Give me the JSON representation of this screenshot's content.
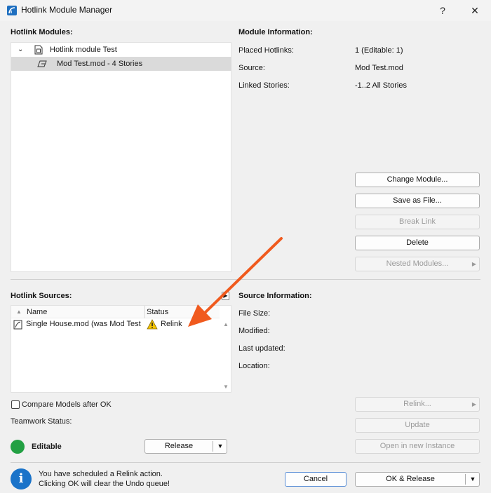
{
  "window": {
    "title": "Hotlink Module Manager",
    "help_label": "?",
    "close_label": "✕"
  },
  "modules": {
    "heading": "Hotlink Modules:",
    "tree": [
      {
        "label": "Hotlink module Test",
        "expanded": true
      },
      {
        "label": "Mod Test.mod - 4 Stories",
        "selected": true
      }
    ]
  },
  "module_info": {
    "heading": "Module Information:",
    "placed_label": "Placed Hotlinks:",
    "placed_value": "1 (Editable: 1)",
    "source_label": "Source:",
    "source_value": "Mod Test.mod",
    "linked_label": "Linked Stories:",
    "linked_value": "-1..2 All Stories"
  },
  "module_buttons": {
    "change": "Change Module...",
    "save": "Save as File...",
    "break": "Break Link",
    "delete": "Delete",
    "nested": "Nested Modules..."
  },
  "sources": {
    "heading": "Hotlink Sources:",
    "col_name": "Name",
    "col_status": "Status",
    "rows": [
      {
        "name": "Single House.mod (was Mod Test",
        "status": "Relink"
      }
    ]
  },
  "source_info": {
    "heading": "Source Information:",
    "size_label": "File Size:",
    "modified_label": "Modified:",
    "updated_label": "Last updated:",
    "location_label": "Location:"
  },
  "compare_label": "Compare Models after OK",
  "teamwork": {
    "label": "Teamwork Status:",
    "status": "Editable",
    "release": "Release"
  },
  "source_buttons": {
    "relink": "Relink...",
    "update": "Update",
    "open_instance": "Open in new Instance"
  },
  "footer": {
    "message_line1": "You have scheduled a Relink action.",
    "message_line2": "Clicking OK will clear the Undo queue!",
    "cancel": "Cancel",
    "ok_release": "OK & Release"
  },
  "colors": {
    "accent_blue": "#1a73c9",
    "status_green": "#22a043",
    "arrow_orange": "#f05a1e",
    "warning_yellow": "#f5c400"
  }
}
